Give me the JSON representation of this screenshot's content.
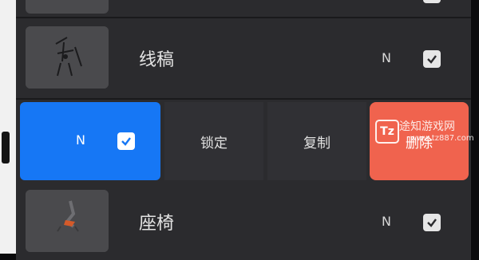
{
  "layers": [
    {
      "name": "",
      "blend": "",
      "visible": true
    },
    {
      "name": "线稿",
      "blend": "N",
      "visible": true
    },
    {
      "name": "座椅",
      "blend": "N",
      "visible": true
    }
  ],
  "selected_layer": {
    "blend": "N",
    "visible": true
  },
  "actions": {
    "lock": "锁定",
    "copy": "复制",
    "delete": "删除"
  },
  "watermark": {
    "logo": "Tz",
    "name": "途知游戏网",
    "url": "www.tz887.com"
  },
  "colors": {
    "selected_row": "#1677f5",
    "delete_button": "#f0634e",
    "panel": "#2b2b2e"
  }
}
